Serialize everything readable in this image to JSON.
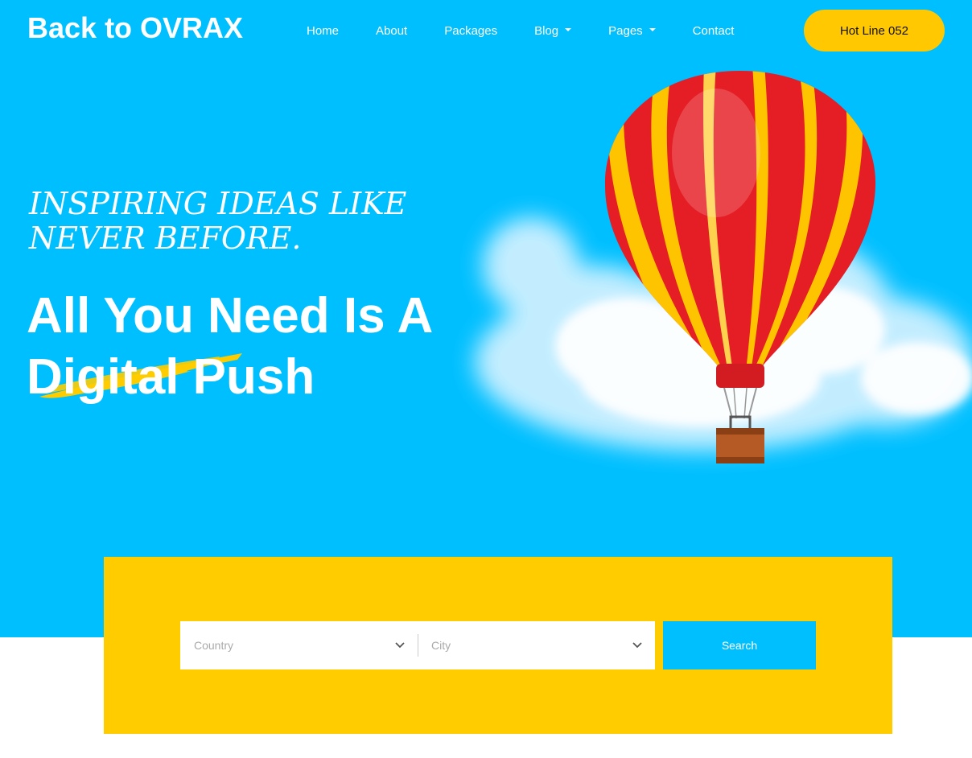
{
  "header": {
    "logo": "Back to OVRAX",
    "nav": [
      {
        "label": "Home"
      },
      {
        "label": "About"
      },
      {
        "label": "Packages"
      },
      {
        "label": "Blog"
      },
      {
        "label": "Pages"
      },
      {
        "label": "Contact"
      }
    ],
    "hotline_label": "Hot Line 052"
  },
  "hero": {
    "tagline": "Inspiring ideas like never before.",
    "headline_line1": "All You Need Is A",
    "headline_line2": "Digital Push"
  },
  "search": {
    "country_placeholder": "Country",
    "city_placeholder": "City",
    "button_label": "Search"
  },
  "colors": {
    "hero_bg": "#00bfff",
    "accent_yellow": "#ffcc00",
    "button_blue": "#00bfff"
  }
}
